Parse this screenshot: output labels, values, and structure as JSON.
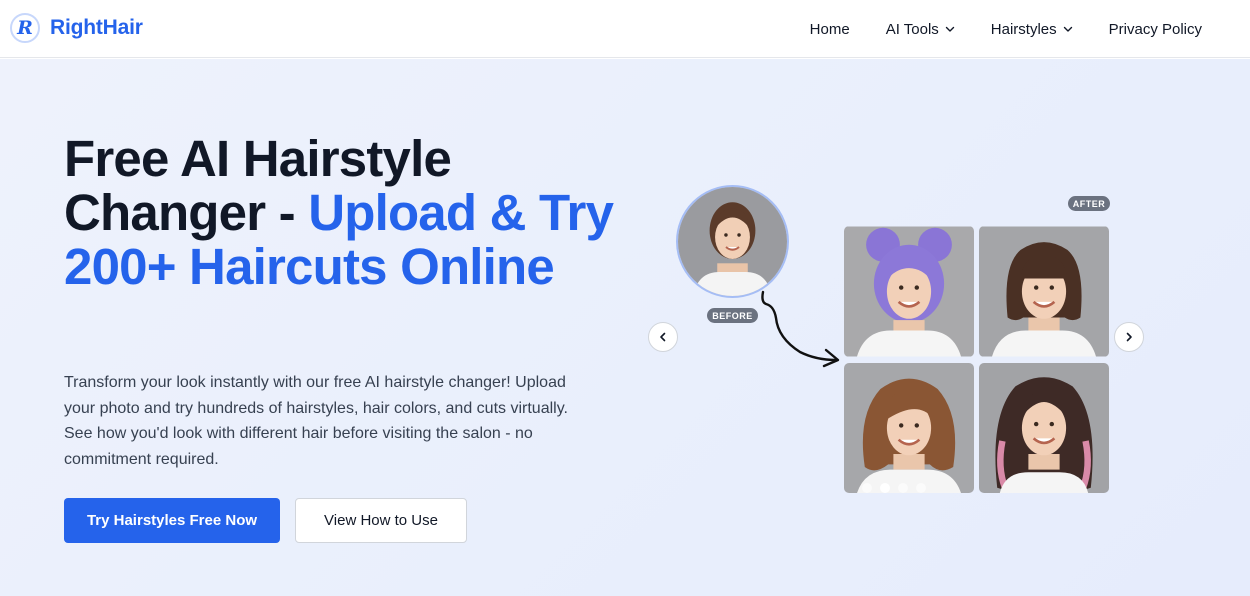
{
  "brand": {
    "logo_letter": "R",
    "name": "RightHair",
    "color": "#2563eb"
  },
  "nav": {
    "items": [
      {
        "label": "Home",
        "has_dropdown": false
      },
      {
        "label": "AI Tools",
        "has_dropdown": true
      },
      {
        "label": "Hairstyles",
        "has_dropdown": true
      },
      {
        "label": "Privacy Policy",
        "has_dropdown": false
      }
    ]
  },
  "hero": {
    "title_part1": "Free AI Hairstyle Changer - ",
    "title_part2": "Upload & Try 200+ Haircuts Online",
    "description": "Transform your look instantly with our free AI hairstyle changer! Upload your photo and try hundreds of hairstyles, hair colors, and cuts virtually. See how you'd look with different hair before visiting the salon - no commitment required.",
    "primary_button": "Try Hairstyles Free Now",
    "secondary_button": "View How to Use"
  },
  "carousel": {
    "before_label": "BEFORE",
    "after_label": "AFTER",
    "prev_icon": "chevron-left-icon",
    "next_icon": "chevron-right-icon",
    "dot_count": 4,
    "active_dot": 1
  },
  "colors": {
    "accent": "#2563eb",
    "hero_bg": "#eaf0fc",
    "badge_bg": "#6b7280"
  }
}
